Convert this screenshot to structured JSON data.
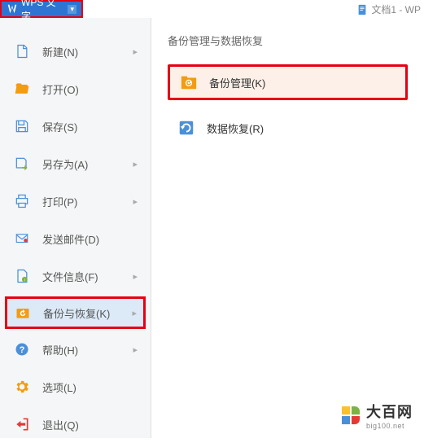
{
  "titlebar": {
    "app_name": "WPS 文字"
  },
  "document": {
    "title": "文档1 - WP"
  },
  "sidebar": {
    "items": [
      {
        "label": "新建(N)",
        "icon": "new"
      },
      {
        "label": "打开(O)",
        "icon": "open"
      },
      {
        "label": "保存(S)",
        "icon": "save"
      },
      {
        "label": "另存为(A)",
        "icon": "saveas"
      },
      {
        "label": "打印(P)",
        "icon": "print"
      },
      {
        "label": "发送邮件(D)",
        "icon": "mail"
      },
      {
        "label": "文件信息(F)",
        "icon": "info"
      },
      {
        "label": "备份与恢复(K)",
        "icon": "backup"
      },
      {
        "label": "帮助(H)",
        "icon": "help"
      },
      {
        "label": "选项(L)",
        "icon": "options"
      },
      {
        "label": "退出(Q)",
        "icon": "exit"
      }
    ]
  },
  "panel": {
    "title": "备份管理与数据恢复",
    "options": [
      {
        "label": "备份管理(K)",
        "icon": "backup-folder"
      },
      {
        "label": "数据恢复(R)",
        "icon": "recover"
      }
    ]
  },
  "watermark": {
    "main": "大百网",
    "sub": "big100.net"
  },
  "colors": {
    "primary": "#2e75d3",
    "highlight": "#e60012",
    "orange": "#f39c12",
    "green": "#7cb342",
    "yellow": "#fbc02d",
    "red": "#e53935"
  }
}
